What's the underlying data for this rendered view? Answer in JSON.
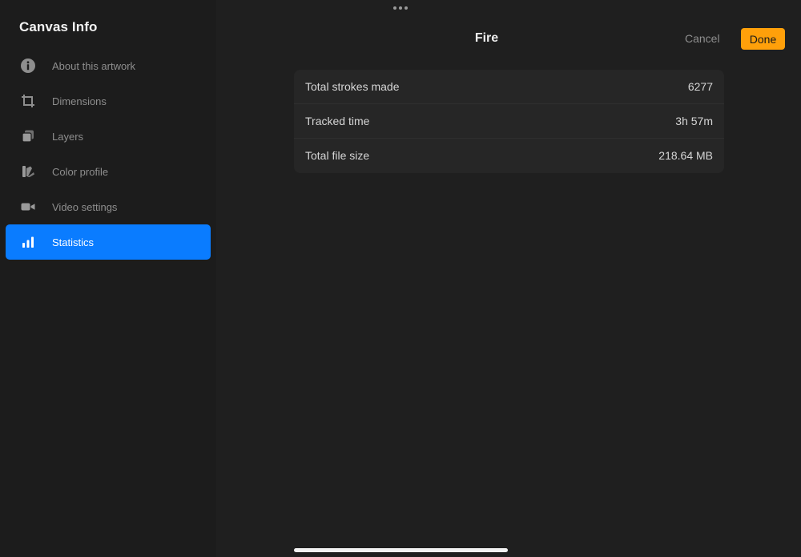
{
  "sidebar": {
    "title": "Canvas Info",
    "items": [
      {
        "label": "About this artwork",
        "icon": "info-icon"
      },
      {
        "label": "Dimensions",
        "icon": "crop-icon"
      },
      {
        "label": "Layers",
        "icon": "layers-icon"
      },
      {
        "label": "Color profile",
        "icon": "color-profile-icon"
      },
      {
        "label": "Video settings",
        "icon": "video-camera-icon"
      },
      {
        "label": "Statistics",
        "icon": "bar-chart-icon",
        "active": true
      }
    ]
  },
  "header": {
    "title": "Fire",
    "cancel_label": "Cancel",
    "done_label": "Done"
  },
  "stats": {
    "rows": [
      {
        "label": "Total strokes made",
        "value": "6277"
      },
      {
        "label": "Tracked time",
        "value": "3h 57m"
      },
      {
        "label": "Total file size",
        "value": "218.64 MB"
      }
    ]
  },
  "colors": {
    "accent_blue": "#0a7cff",
    "done_orange": "#ffa00a",
    "background": "#1f1f1f"
  }
}
